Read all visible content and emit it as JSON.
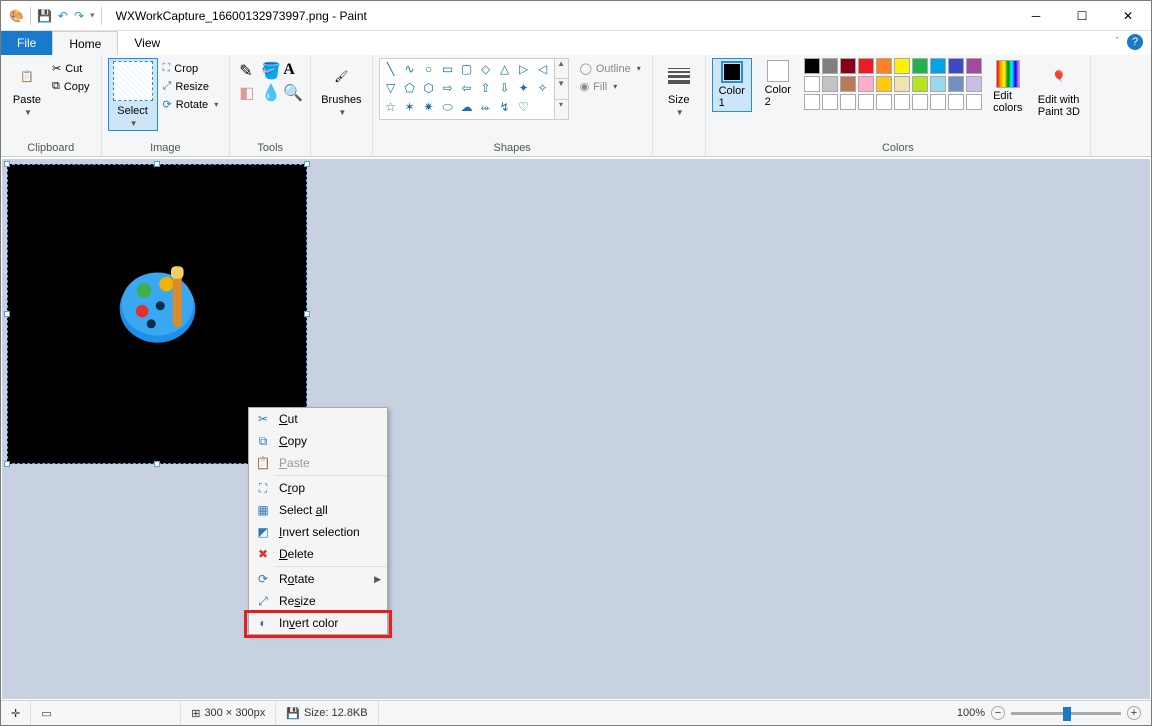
{
  "title": "WXWorkCapture_16600132973997.png - Paint",
  "tabs": {
    "file": "File",
    "home": "Home",
    "view": "View"
  },
  "ribbon_groups": {
    "clipboard": "Clipboard",
    "image": "Image",
    "tools": "Tools",
    "shapes": "Shapes",
    "colors": "Colors"
  },
  "clipboard": {
    "paste": "Paste",
    "cut": "Cut",
    "copy": "Copy"
  },
  "image": {
    "select": "Select",
    "crop": "Crop",
    "resize": "Resize",
    "rotate": "Rotate"
  },
  "tools": {
    "brushes": "Brushes"
  },
  "shapes": {
    "outline": "Outline",
    "fill": "Fill"
  },
  "size_label": "Size",
  "colors": {
    "color1": "Color\n1",
    "color2": "Color\n2",
    "edit": "Edit\ncolors",
    "paint3d": "Edit with\nPaint 3D"
  },
  "palette_colors_row1": [
    "#000000",
    "#7f7f7f",
    "#880015",
    "#ed1c24",
    "#ff7f27",
    "#fff200",
    "#22b14c",
    "#00a2e8",
    "#3f48cc",
    "#a349a4"
  ],
  "palette_colors_row2": [
    "#ffffff",
    "#c3c3c3",
    "#b97a57",
    "#ffaec9",
    "#ffc90e",
    "#efe4b0",
    "#b5e61d",
    "#99d9ea",
    "#7092be",
    "#c8bfe7"
  ],
  "palette_colors_row3": [
    "#ffffff",
    "#ffffff",
    "#ffffff",
    "#ffffff",
    "#ffffff",
    "#ffffff",
    "#ffffff",
    "#ffffff",
    "#ffffff",
    "#ffffff"
  ],
  "context_menu": {
    "cut": "Cut",
    "copy": "Copy",
    "paste": "Paste",
    "crop": "Crop",
    "select_all": "Select all",
    "invert_selection": "Invert selection",
    "delete": "Delete",
    "rotate": "Rotate",
    "resize": "Resize",
    "invert_color": "Invert color"
  },
  "status": {
    "dims": "300 × 300px",
    "size": "Size: 12.8KB",
    "zoom": "100%"
  }
}
